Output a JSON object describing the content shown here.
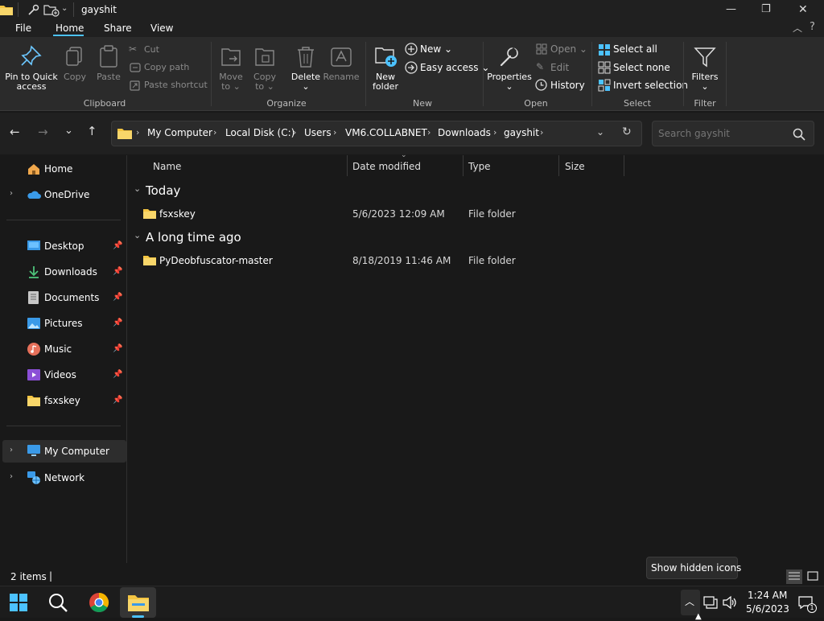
{
  "window": {
    "title": "gayshit",
    "controls": {
      "minimize": "—",
      "restore": "❐",
      "close": "✕"
    }
  },
  "menu": {
    "tabs": [
      {
        "label": "File"
      },
      {
        "label": "Home"
      },
      {
        "label": "Share"
      },
      {
        "label": "View"
      }
    ],
    "active": "Home"
  },
  "ribbon": {
    "clipboard": {
      "pin": "Pin to Quick",
      "pin2": "access",
      "copy": "Copy",
      "paste": "Paste",
      "cut": "Cut",
      "copy_path": "Copy path",
      "paste_shortcut": "Paste shortcut",
      "group": "Clipboard"
    },
    "organize": {
      "move": "Move",
      "move_to": "to",
      "copy": "Copy",
      "copy_to": "to",
      "delete": "Delete",
      "rename": "Rename",
      "group": "Organize"
    },
    "new": {
      "new_folder": "New",
      "new_folder2": "folder",
      "new_item": "New",
      "easy_access": "Easy access",
      "group": "New"
    },
    "open": {
      "properties": "Properties",
      "open": "Open",
      "edit": "Edit",
      "history": "History",
      "group": "Open"
    },
    "select": {
      "select_all": "Select all",
      "select_none": "Select none",
      "invert": "Invert selection",
      "group": "Select"
    },
    "filter": {
      "filters": "Filters",
      "group": "Filter"
    }
  },
  "address": {
    "crumbs": [
      "My Computer",
      "Local Disk (C:)",
      "Users",
      "VM6.COLLABNET",
      "Downloads",
      "gayshit"
    ],
    "search_placeholder": "Search gayshit"
  },
  "nav": {
    "home": "Home",
    "onedrive": "OneDrive",
    "desktop": "Desktop",
    "downloads": "Downloads",
    "documents": "Documents",
    "pictures": "Pictures",
    "music": "Music",
    "videos": "Videos",
    "fsxskey": "fsxskey",
    "my_computer": "My Computer",
    "network": "Network"
  },
  "columns": {
    "name": "Name",
    "date": "Date modified",
    "type": "Type",
    "size": "Size"
  },
  "groups": [
    {
      "label": "Today",
      "files": [
        {
          "name": "fsxskey",
          "date": "5/6/2023 12:09 AM",
          "type": "File folder",
          "size": ""
        }
      ]
    },
    {
      "label": "A long time ago",
      "files": [
        {
          "name": "PyDeobfuscator-master",
          "date": "8/18/2019 11:46 AM",
          "type": "File folder",
          "size": ""
        }
      ]
    }
  ],
  "status": {
    "count": "2 items",
    "cursor": "|"
  },
  "tooltip": "Show hidden icons",
  "clock": {
    "time": "1:24 AM",
    "date": "5/6/2023"
  },
  "notifications": {
    "count": "1"
  },
  "colors": {
    "accent": "#4cc2ff",
    "folder": "#f4c542",
    "bg": "#191919"
  }
}
